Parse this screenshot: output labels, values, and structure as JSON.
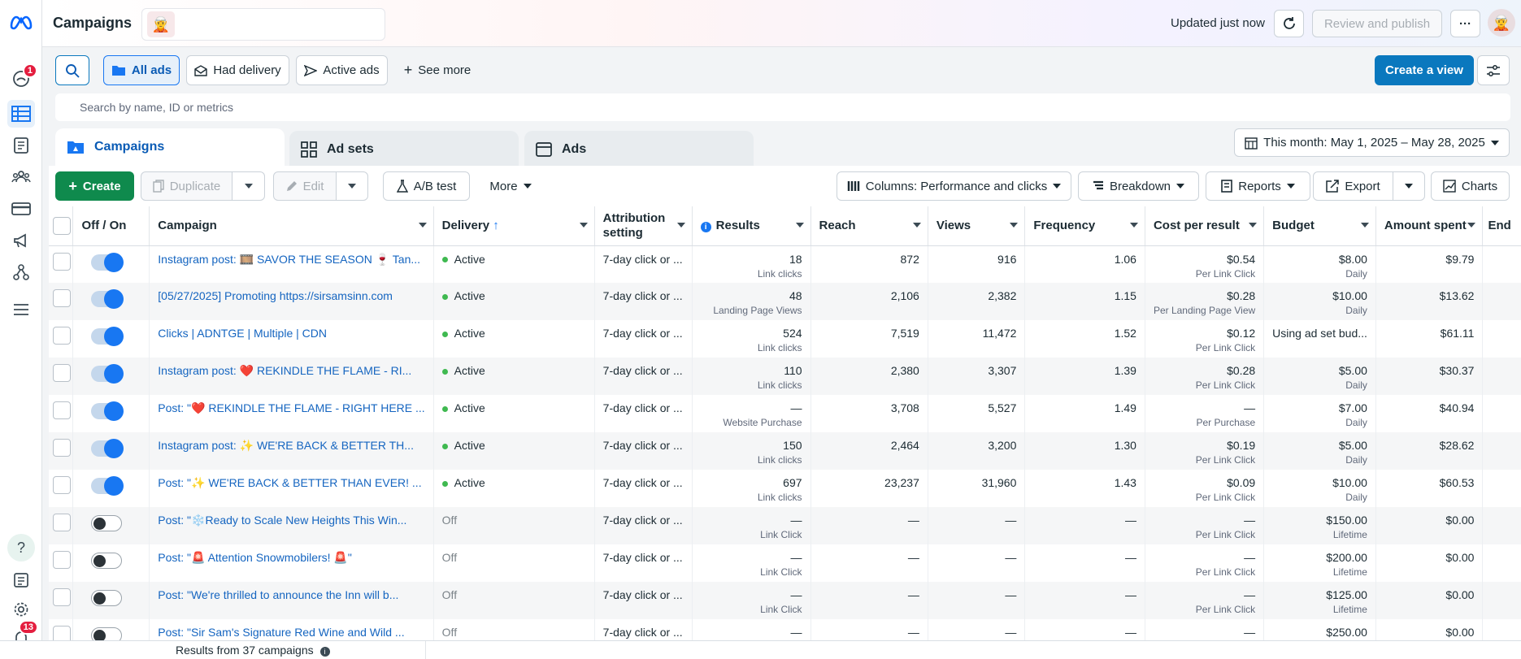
{
  "sidebar": {
    "notifications_badge": "1",
    "bell_badge": "13"
  },
  "topbar": {
    "title": "Campaigns",
    "updated": "Updated just now",
    "review_publish": "Review and publish",
    "more": "···"
  },
  "filters": {
    "all_ads": "All ads",
    "had_delivery": "Had delivery",
    "active_ads": "Active ads",
    "see_more": "See more",
    "create_view": "Create a view"
  },
  "search": {
    "placeholder": "Search by name, ID or metrics"
  },
  "tabs": [
    {
      "label": "Campaigns"
    },
    {
      "label": "Ad sets"
    },
    {
      "label": "Ads"
    }
  ],
  "date_range": "This month: May 1, 2025 – May 28, 2025",
  "toolbar": {
    "create": "Create",
    "duplicate": "Duplicate",
    "edit": "Edit",
    "ab_test": "A/B test",
    "more": "More",
    "columns": "Columns: Performance and clicks",
    "breakdown": "Breakdown",
    "reports": "Reports",
    "export": "Export",
    "charts": "Charts"
  },
  "columns": [
    "Off / On",
    "Campaign",
    "Delivery",
    "Attribution setting",
    "Results",
    "Reach",
    "Views",
    "Frequency",
    "Cost per result",
    "Budget",
    "Amount spent",
    "End"
  ],
  "rows": [
    {
      "on": true,
      "campaign": "Instagram post: 🎞️ SAVOR THE SEASON 🍷 Tan...",
      "delivery": "Active",
      "attribution": "7-day click or ...",
      "results": "18",
      "results_sub": "Link clicks",
      "reach": "872",
      "views": "916",
      "frequency": "1.06",
      "cpr": "$0.54",
      "cpr_sub": "Per Link Click",
      "budget": "$8.00",
      "budget_sub": "Daily",
      "spent": "$9.79"
    },
    {
      "on": true,
      "campaign": "[05/27/2025] Promoting https://sirsamsinn.com",
      "delivery": "Active",
      "attribution": "7-day click or ...",
      "results": "48",
      "results_sub": "Landing Page Views",
      "reach": "2,106",
      "views": "2,382",
      "frequency": "1.15",
      "cpr": "$0.28",
      "cpr_sub": "Per Landing Page View",
      "budget": "$10.00",
      "budget_sub": "Daily",
      "spent": "$13.62"
    },
    {
      "on": true,
      "campaign": "Clicks | ADNTGE | Multiple | CDN",
      "delivery": "Active",
      "attribution": "7-day click or ...",
      "results": "524",
      "results_sub": "Link clicks",
      "reach": "7,519",
      "views": "11,472",
      "frequency": "1.52",
      "cpr": "$0.12",
      "cpr_sub": "Per Link Click",
      "budget": "Using ad set bud...",
      "budget_sub": "",
      "spent": "$61.11"
    },
    {
      "on": true,
      "campaign": "Instagram post: ❤️ REKINDLE THE FLAME - RI...",
      "delivery": "Active",
      "attribution": "7-day click or ...",
      "results": "110",
      "results_sub": "Link clicks",
      "reach": "2,380",
      "views": "3,307",
      "frequency": "1.39",
      "cpr": "$0.28",
      "cpr_sub": "Per Link Click",
      "budget": "$5.00",
      "budget_sub": "Daily",
      "spent": "$30.37"
    },
    {
      "on": true,
      "campaign": "Post: \"❤️ REKINDLE THE FLAME - RIGHT HERE ...",
      "delivery": "Active",
      "attribution": "7-day click or ...",
      "results": "—",
      "results_sub": "Website Purchase",
      "reach": "3,708",
      "views": "5,527",
      "frequency": "1.49",
      "cpr": "—",
      "cpr_sub": "Per Purchase",
      "budget": "$7.00",
      "budget_sub": "Daily",
      "spent": "$40.94"
    },
    {
      "on": true,
      "campaign": "Instagram post: ✨ WE'RE BACK & BETTER TH...",
      "delivery": "Active",
      "attribution": "7-day click or ...",
      "results": "150",
      "results_sub": "Link clicks",
      "reach": "2,464",
      "views": "3,200",
      "frequency": "1.30",
      "cpr": "$0.19",
      "cpr_sub": "Per Link Click",
      "budget": "$5.00",
      "budget_sub": "Daily",
      "spent": "$28.62"
    },
    {
      "on": true,
      "campaign": "Post: \"✨ WE'RE BACK & BETTER THAN EVER! ...",
      "delivery": "Active",
      "attribution": "7-day click or ...",
      "results": "697",
      "results_sub": "Link clicks",
      "reach": "23,237",
      "views": "31,960",
      "frequency": "1.43",
      "cpr": "$0.09",
      "cpr_sub": "Per Link Click",
      "budget": "$10.00",
      "budget_sub": "Daily",
      "spent": "$60.53"
    },
    {
      "on": false,
      "campaign": "Post: \"❄️Ready to Scale New Heights This Win...",
      "delivery": "Off",
      "attribution": "7-day click or ...",
      "results": "—",
      "results_sub": "Link Click",
      "reach": "—",
      "views": "—",
      "frequency": "—",
      "cpr": "—",
      "cpr_sub": "Per Link Click",
      "budget": "$150.00",
      "budget_sub": "Lifetime",
      "spent": "$0.00"
    },
    {
      "on": false,
      "campaign": "Post: \"🚨 Attention Snowmobilers! 🚨\"",
      "delivery": "Off",
      "attribution": "7-day click or ...",
      "results": "—",
      "results_sub": "Link Click",
      "reach": "—",
      "views": "—",
      "frequency": "—",
      "cpr": "—",
      "cpr_sub": "Per Link Click",
      "budget": "$200.00",
      "budget_sub": "Lifetime",
      "spent": "$0.00"
    },
    {
      "on": false,
      "campaign": "Post: \"We're thrilled to announce the Inn will b...",
      "delivery": "Off",
      "attribution": "7-day click or ...",
      "results": "—",
      "results_sub": "Link Click",
      "reach": "—",
      "views": "—",
      "frequency": "—",
      "cpr": "—",
      "cpr_sub": "Per Link Click",
      "budget": "$125.00",
      "budget_sub": "Lifetime",
      "spent": "$0.00"
    },
    {
      "on": false,
      "campaign": "Post: \"Sir Sam's Signature Red Wine and Wild ...",
      "delivery": "Off",
      "attribution": "7-day click or ...",
      "results": "—",
      "results_sub": "",
      "reach": "—",
      "views": "—",
      "frequency": "—",
      "cpr": "—",
      "cpr_sub": "",
      "budget": "$250.00",
      "budget_sub": "",
      "spent": "$0.00"
    }
  ],
  "footer": {
    "results_from": "Results from 37 campaigns"
  },
  "colors": {
    "accent": "#0a78be",
    "create": "#0f8a4d",
    "active_dot": "#3fb950",
    "toggle_on": "#1877f2",
    "badge": "#e41e3f"
  }
}
